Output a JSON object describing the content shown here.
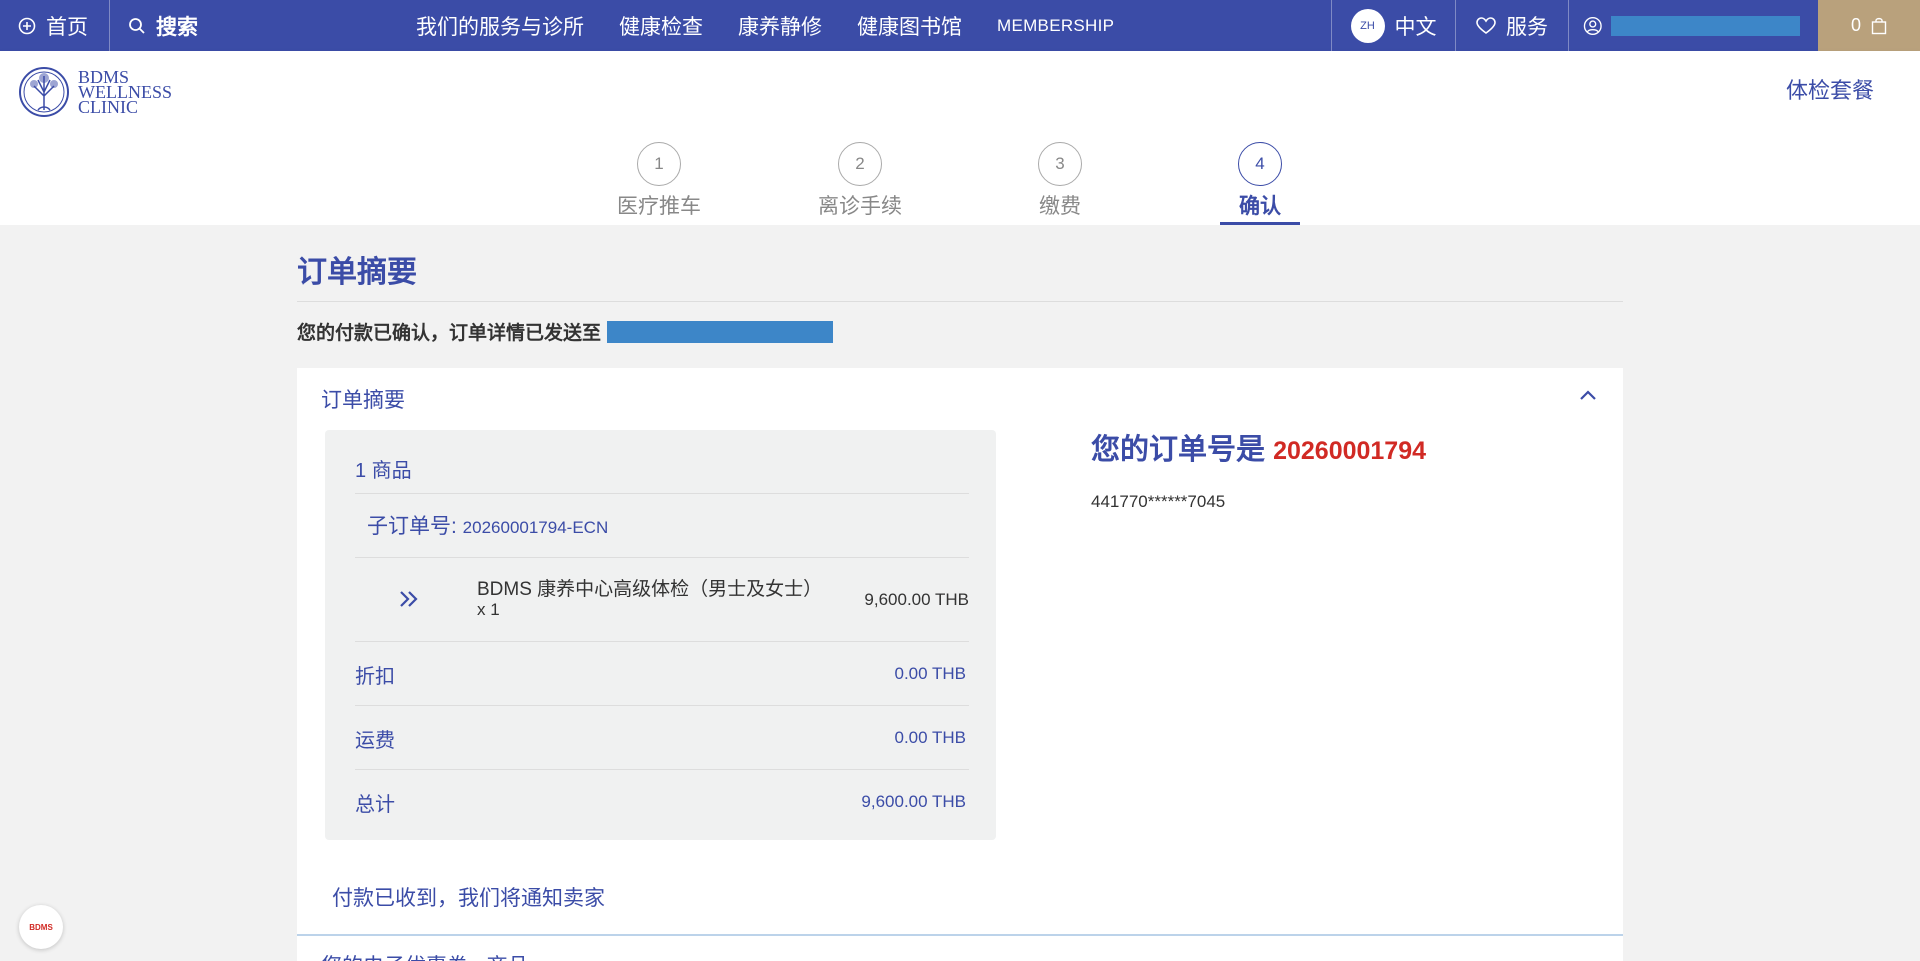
{
  "topnav": {
    "home": "首页",
    "search": "搜索",
    "menu": [
      "我们的服务与诊所",
      "健康检查",
      "康养静修",
      "健康图书馆",
      "MEMBERSHIP"
    ],
    "lang_badge": "ZH",
    "lang": "中文",
    "service": "服务",
    "cart_count": "0"
  },
  "header": {
    "logo_lines": [
      "BDMS",
      "WELLNESS",
      "CLINIC"
    ],
    "link": "体检套餐"
  },
  "steps": [
    {
      "num": "1",
      "label": "医疗推车"
    },
    {
      "num": "2",
      "label": "离诊手续"
    },
    {
      "num": "3",
      "label": "缴费"
    },
    {
      "num": "4",
      "label": "确认"
    }
  ],
  "page": {
    "title": "订单摘要",
    "confirm_text": "您的付款已确认，订单详情已发送至"
  },
  "card": {
    "heading": "订单摘要",
    "item_count": "1 商品",
    "suborder_label": "子订单号: ",
    "suborder_no": "20260001794-ECN",
    "item": {
      "name": "BDMS 康养中心高级体检（男士及女士）",
      "qty": "x 1",
      "price": "9,600.00 THB"
    },
    "lines": [
      {
        "label": "折扣",
        "value": "0.00 THB"
      },
      {
        "label": "运费",
        "value": "0.00 THB"
      },
      {
        "label": "总计",
        "value": "9,600.00 THB"
      }
    ],
    "order_prefix": "您的订单号是",
    "order_no": "20260001794",
    "card_number": "441770******7045",
    "notice": "付款已收到，我们将通知卖家",
    "cut_text": "您的电子优惠券 · 商品"
  },
  "badge": "BDMS",
  "colors": {
    "primary": "#3b4ca7",
    "accent_gold": "#b9a17c",
    "red": "#d12a24"
  }
}
